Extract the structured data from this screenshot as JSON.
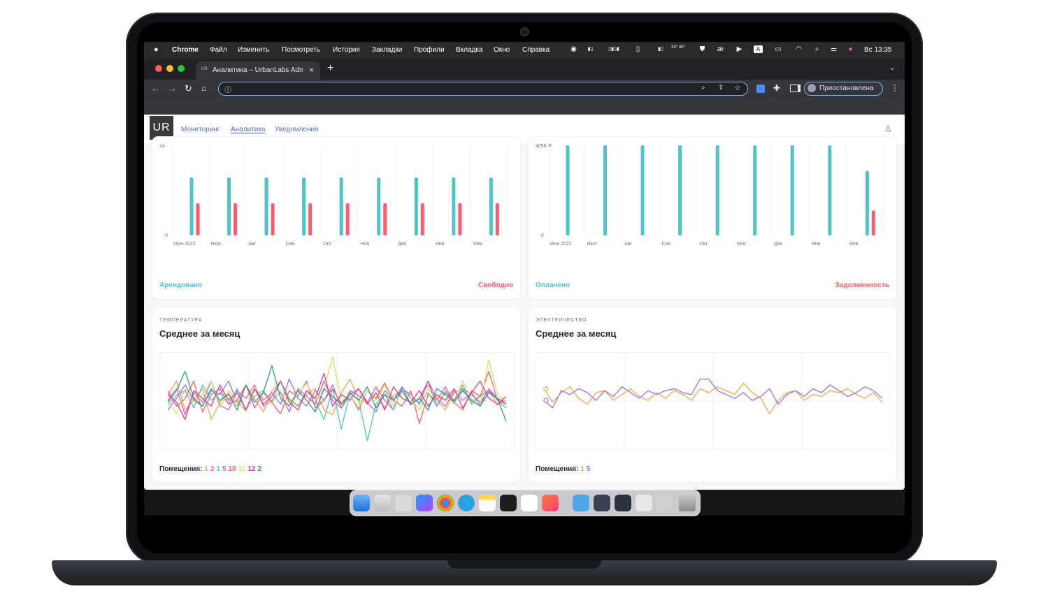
{
  "menubar": {
    "app": "Chrome",
    "items": [
      "Файл",
      "Изменить",
      "Посмотреть",
      "История",
      "Закладки",
      "Профили",
      "Вкладка",
      "Окно",
      "Справка"
    ],
    "clock": "Вс 13:35",
    "weather": "33° 30°"
  },
  "browser": {
    "tab_title": "Аналитика – UrbanLabs Admi",
    "tab_icon_text": "UR",
    "new_tab": "+",
    "profile_status": "Приостановлена"
  },
  "app": {
    "logo": "UR",
    "nav": [
      "Мониторинг",
      "Аналитика",
      "Уведомления"
    ]
  },
  "occupancy_card": {
    "legend_left": "Арендовано",
    "legend_right": "Свободно"
  },
  "payments_card": {
    "legend_left": "Оплачено",
    "legend_right": "Задолженность"
  },
  "temperature_card": {
    "category": "ТЕМПЕРАТУРА",
    "title": "Среднее за месяц",
    "rooms_label": "Помещения:",
    "rooms": [
      {
        "n": "1",
        "color": "#f5a54a"
      },
      {
        "n": "2",
        "color": "#e85ad0"
      },
      {
        "n": "1",
        "color": "#4cc4c0"
      },
      {
        "n": "5",
        "color": "#a56de2"
      },
      {
        "n": "10",
        "color": "#ff5b6e"
      },
      {
        "n": "11",
        "color": "#c9e85a"
      },
      {
        "n": "12",
        "color": "#e8408c"
      },
      {
        "n": "2",
        "color": "#2a9d8f"
      }
    ]
  },
  "electricity_card": {
    "category": "ЭЛЕКТРИЧЕСТВО",
    "title": "Среднее за месяц",
    "rooms_label": "Помещения:",
    "rooms": [
      {
        "n": "1",
        "color": "#f5a54a"
      },
      {
        "n": "5",
        "color": "#a56de2"
      }
    ]
  },
  "chart_data": [
    {
      "type": "bar",
      "categories": [
        "Июн 2022",
        "Июл",
        "Авг",
        "Сен",
        "Окт",
        "Ноя",
        "Дек",
        "Янв",
        "Фев"
      ],
      "ylim": [
        0,
        14
      ],
      "yticks": [
        "14",
        "0"
      ],
      "series": [
        {
          "name": "Арендовано",
          "color": "#4ec3c8",
          "values": [
            9,
            9,
            9,
            9,
            9,
            9,
            9,
            9,
            9
          ]
        },
        {
          "name": "Свободно",
          "color": "#ff5b6e",
          "values": [
            5,
            5,
            5,
            5,
            5,
            5,
            5,
            5,
            5
          ]
        }
      ]
    },
    {
      "type": "bar",
      "categories": [
        "Июн 2022",
        "Июл",
        "Авг",
        "Сен",
        "Окт",
        "Ноя",
        "Дек",
        "Янв",
        "Фев"
      ],
      "ylim": [
        0,
        405000
      ],
      "yticks": [
        "405K ₽",
        "0"
      ],
      "series": [
        {
          "name": "Оплачено",
          "color": "#4ec3c8",
          "values": [
            405000,
            405000,
            405000,
            405000,
            405000,
            405000,
            405000,
            405000,
            290000
          ]
        },
        {
          "name": "Задолженность",
          "color": "#ff5b6e",
          "values": [
            0,
            0,
            0,
            0,
            0,
            0,
            0,
            0,
            112000
          ]
        }
      ]
    },
    {
      "type": "line",
      "x_count": 40,
      "series": [
        {
          "color": "#f5a54a",
          "values": [
            0.55,
            0.7,
            0.4,
            0.5,
            0.62,
            0.3,
            0.48,
            0.58,
            0.44,
            0.66,
            0.52,
            0.38,
            0.6,
            0.7,
            0.5,
            0.45,
            0.56,
            0.62,
            0.4,
            0.35,
            0.58,
            0.72,
            0.5,
            0.48,
            0.64,
            0.42,
            0.55,
            0.6,
            0.45,
            0.52,
            0.66,
            0.5,
            0.4,
            0.58,
            0.62,
            0.48,
            0.55,
            0.6,
            0.45,
            0.5
          ]
        },
        {
          "color": "#e85ad0",
          "values": [
            0.5,
            0.62,
            0.35,
            0.58,
            0.48,
            0.7,
            0.45,
            0.4,
            0.6,
            0.52,
            0.66,
            0.44,
            0.5,
            0.58,
            0.38,
            0.62,
            0.54,
            0.46,
            0.7,
            0.5,
            0.42,
            0.6,
            0.55,
            0.48,
            0.64,
            0.5,
            0.4,
            0.62,
            0.56,
            0.46,
            0.7,
            0.52,
            0.44,
            0.6,
            0.5,
            0.58,
            0.45,
            0.62,
            0.52,
            0.48
          ]
        },
        {
          "color": "#4cc4c0",
          "values": [
            0.45,
            0.55,
            0.6,
            0.42,
            0.66,
            0.5,
            0.58,
            0.46,
            0.62,
            0.4,
            0.54,
            0.6,
            0.48,
            0.7,
            0.52,
            0.44,
            0.6,
            0.5,
            0.3,
            0.62,
            0.2,
            0.58,
            0.5,
            0.08,
            0.46,
            0.56,
            0.4,
            0.64,
            0.52,
            0.48,
            0.58,
            0.44,
            0.6,
            0.5,
            0.66,
            0.46,
            0.54,
            0.6,
            0.5,
            0.42
          ]
        },
        {
          "color": "#a56de2",
          "values": [
            0.4,
            0.52,
            0.66,
            0.5,
            0.44,
            0.6,
            0.56,
            0.7,
            0.48,
            0.4,
            0.62,
            0.5,
            0.58,
            0.46,
            0.72,
            0.52,
            0.44,
            0.6,
            0.5,
            0.66,
            0.42,
            0.56,
            0.62,
            0.48,
            0.38,
            0.6,
            0.5,
            0.64,
            0.46,
            0.52,
            0.7,
            0.44,
            0.58,
            0.5,
            0.62,
            0.56,
            0.48,
            0.6,
            0.52,
            0.46
          ]
        },
        {
          "color": "#ff5b6e",
          "values": [
            0.6,
            0.44,
            0.52,
            0.7,
            0.38,
            0.56,
            0.62,
            0.46,
            0.5,
            0.66,
            0.42,
            0.58,
            0.48,
            0.36,
            0.6,
            0.54,
            0.7,
            0.42,
            0.5,
            0.62,
            0.46,
            0.56,
            0.4,
            0.6,
            0.52,
            0.68,
            0.5,
            0.44,
            0.6,
            0.26,
            0.56,
            0.5,
            0.64,
            0.48,
            0.4,
            0.6,
            0.54,
            0.8,
            0.5,
            0.46
          ]
        },
        {
          "color": "#c9e85a",
          "values": [
            0.5,
            0.36,
            0.62,
            0.48,
            0.55,
            0.7,
            0.42,
            0.6,
            0.5,
            0.38,
            0.64,
            0.52,
            0.46,
            0.6,
            0.44,
            0.56,
            0.68,
            0.5,
            0.62,
            0.95,
            0.48,
            0.56,
            0.42,
            0.6,
            0.5,
            0.66,
            0.44,
            0.58,
            0.52,
            0.4,
            0.62,
            0.5,
            0.56,
            0.46,
            0.7,
            0.52,
            0.44,
            0.92,
            0.56,
            0.48
          ]
        },
        {
          "color": "#e8408c",
          "values": [
            0.56,
            0.48,
            0.3,
            0.6,
            0.52,
            0.44,
            0.66,
            0.5,
            0.58,
            0.4,
            0.62,
            0.46,
            0.54,
            0.7,
            0.48,
            0.4,
            0.6,
            0.52,
            0.78,
            0.44,
            0.56,
            0.5,
            0.62,
            0.46,
            0.58,
            0.4,
            0.64,
            0.52,
            0.48,
            0.6,
            0.44,
            0.56,
            0.5,
            0.62,
            0.42,
            0.58,
            0.7,
            0.52,
            0.46,
            0.54
          ]
        },
        {
          "color": "#2a9d8f",
          "values": [
            0.48,
            0.6,
            0.8,
            0.52,
            0.44,
            0.62,
            0.5,
            0.56,
            0.4,
            0.66,
            0.48,
            0.58,
            0.86,
            0.52,
            0.44,
            0.6,
            0.5,
            0.38,
            0.62,
            0.54,
            0.46,
            0.58,
            0.5,
            0.64,
            0.42,
            0.56,
            0.5,
            0.6,
            0.46,
            0.52,
            0.4,
            0.62,
            0.56,
            0.48,
            0.6,
            0.5,
            0.44,
            0.58,
            0.52,
            0.28
          ]
        }
      ]
    },
    {
      "type": "line",
      "x_count": 40,
      "series": [
        {
          "color": "#f5a54a",
          "values": [
            0.62,
            0.48,
            0.58,
            0.64,
            0.52,
            0.46,
            0.58,
            0.6,
            0.5,
            0.56,
            0.62,
            0.54,
            0.5,
            0.58,
            0.52,
            0.6,
            0.56,
            0.5,
            0.62,
            0.58,
            0.64,
            0.6,
            0.56,
            0.68,
            0.58,
            0.52,
            0.36,
            0.5,
            0.58,
            0.6,
            0.5,
            0.56,
            0.54,
            0.6,
            0.58,
            0.62,
            0.56,
            0.52,
            0.58,
            0.48
          ]
        },
        {
          "color": "#a56de2",
          "values": [
            0.5,
            0.42,
            0.6,
            0.56,
            0.62,
            0.58,
            0.5,
            0.6,
            0.54,
            0.64,
            0.58,
            0.52,
            0.6,
            0.56,
            0.6,
            0.62,
            0.58,
            0.56,
            0.72,
            0.72,
            0.6,
            0.56,
            0.52,
            0.58,
            0.5,
            0.54,
            0.62,
            0.46,
            0.56,
            0.6,
            0.54,
            0.62,
            0.58,
            0.66,
            0.6,
            0.54,
            0.58,
            0.64,
            0.6,
            0.52
          ]
        }
      ]
    }
  ]
}
